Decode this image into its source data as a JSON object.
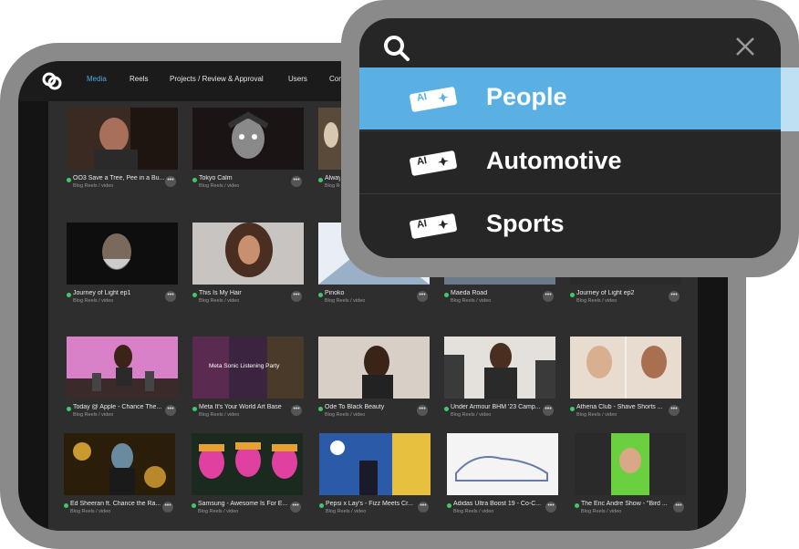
{
  "nav": {
    "items": [
      "Media",
      "Reels",
      "Projects / Review & Approval",
      "Users",
      "Con"
    ],
    "active": "Media"
  },
  "colors": {
    "accent": "#4fa8e8",
    "status_ok": "#3fc96b",
    "highlight": "#5ab0e2"
  },
  "grid": {
    "cards": [
      {
        "title": "OO3 Save a Tree, Pee in a Bu...",
        "subtitle": "Blog Reels / video"
      },
      {
        "title": "Tokyo Calm",
        "subtitle": "Blog Reels / video"
      },
      {
        "title": "Alway",
        "subtitle": "Blog Reels / video"
      },
      {
        "title": "Journey of Light ep1",
        "subtitle": "Blog Reels / video"
      },
      {
        "title": "This Is My Hair",
        "subtitle": "Blog Reels / video"
      },
      {
        "title": "Pinoko",
        "subtitle": "Blog Reels / video"
      },
      {
        "title": "Maeda Road",
        "subtitle": "Blog Reels / video"
      },
      {
        "title": "Journey of Light ep2",
        "subtitle": "Blog Reels / video"
      },
      {
        "title": "Today @ Apple - Chance The...",
        "subtitle": "Blog Reels / video"
      },
      {
        "title": "Meta It's Your World Art Base",
        "subtitle": "Blog Reels / video",
        "thumb_text": "Meta Sonic Listening Party"
      },
      {
        "title": "Ode To Black Beauty",
        "subtitle": "Blog Reels / video"
      },
      {
        "title": "Under Armour BHM '23 Camp...",
        "subtitle": "Blog Reels / video"
      },
      {
        "title": "Athena Club - Shave Shorts ...",
        "subtitle": "Blog Reels / video"
      },
      {
        "title": "Ed Sheeran ft. Chance the Ra...",
        "subtitle": "Blog Reels / video"
      },
      {
        "title": "Samsung - Awesome Is For E...",
        "subtitle": "Blog Reels / video"
      },
      {
        "title": "Pepsi x Lay's - Fizz Meets Cr...",
        "subtitle": "Blog Reels / video"
      },
      {
        "title": "Adidas Ultra Boost 19 - Co-C...",
        "subtitle": "Blog Reels / video"
      },
      {
        "title": "The Eric Andre Show - \"Bird ...",
        "subtitle": "Blog Reels / video"
      }
    ],
    "more_glyph": "•••"
  },
  "search": {
    "query": "",
    "results": [
      {
        "label": "People",
        "badge": "AI",
        "selected": true
      },
      {
        "label": "Automotive",
        "badge": "AI",
        "selected": false
      },
      {
        "label": "Sports",
        "badge": "AI",
        "selected": false
      }
    ]
  }
}
